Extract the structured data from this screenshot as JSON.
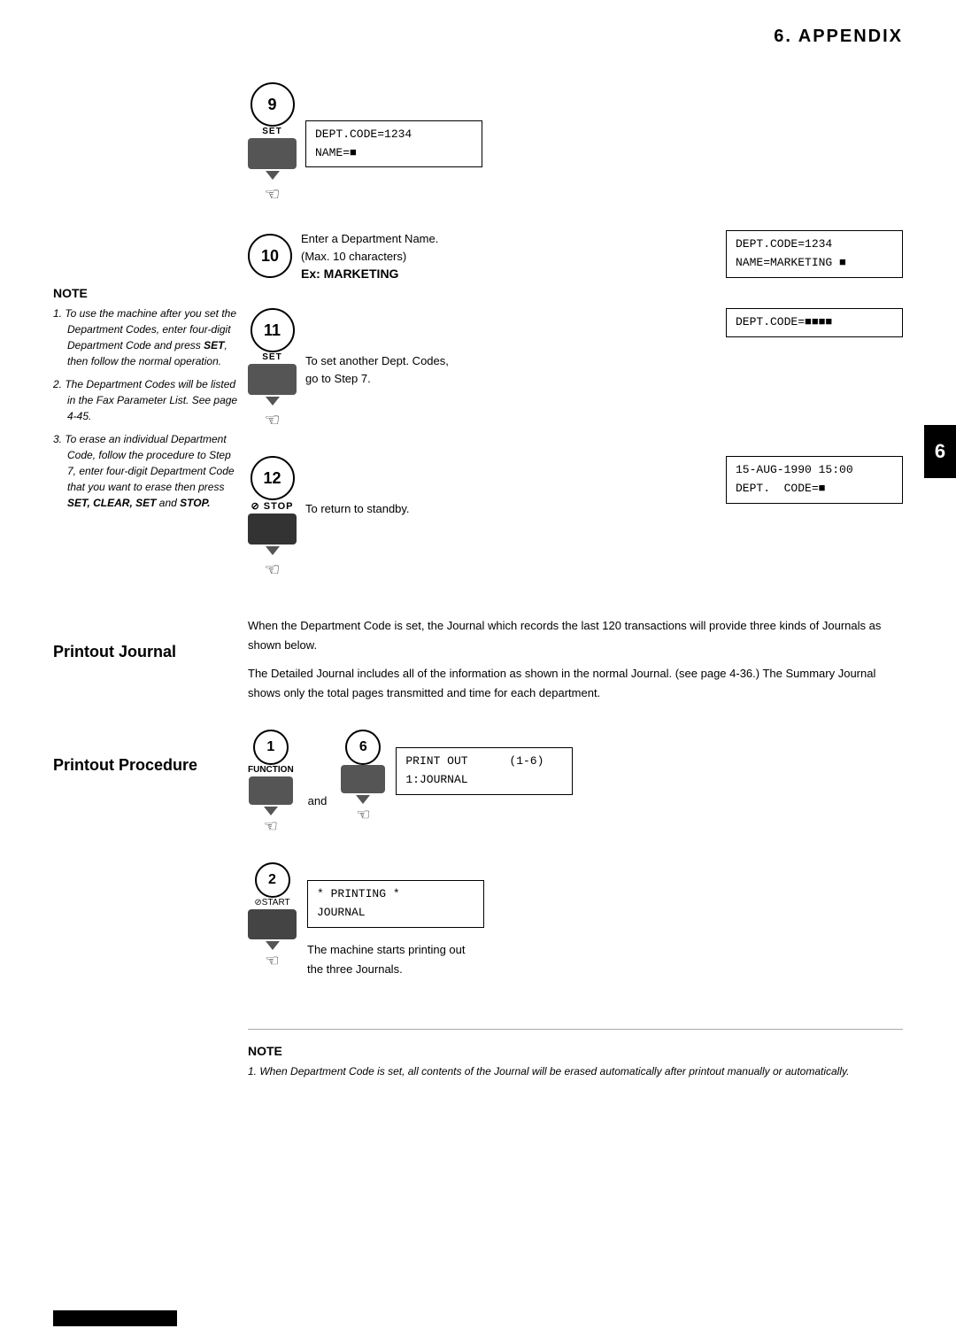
{
  "header": {
    "title": "6.  APPENDIX"
  },
  "tab": "6",
  "steps_top": [
    {
      "number": "9",
      "has_set_label": true,
      "set_label": "SET",
      "display": "DEPT.CODE=1234\nNAME=■"
    },
    {
      "number": "10",
      "description_line1": "Enter a Department Name.",
      "description_line2": "(Max. 10 characters)",
      "ex_label": "Ex:",
      "ex_value": "MARKETING",
      "display": "DEPT.CODE=1234\nNAME=MARKETING ■"
    },
    {
      "number": "11",
      "has_set_label": true,
      "set_label": "SET",
      "sub_note": "To set another Dept. Codes,\ngo to Step 7.",
      "display": "DEPT.CODE=■■■■"
    },
    {
      "number": "12",
      "has_stop_label": true,
      "stop_label": "⊘ STOP",
      "sub_note": "To return to standby.",
      "display": "15-AUG-1990 15:00\nDEPT.  CODE=■"
    }
  ],
  "note_left": {
    "title": "NOTE",
    "items": [
      {
        "num": "1",
        "text": "To use the machine after you set the Department Codes, enter four-digit Department Code and press SET, then follow the normal operation."
      },
      {
        "num": "2",
        "text": "The Department Codes will be listed in the Fax Parameter List. See page 4-45."
      },
      {
        "num": "3",
        "text": "To erase an individual Department Code, follow the procedure to Step 7, enter four-digit Department Code that you want to erase then press SET, CLEAR, SET and STOP."
      }
    ]
  },
  "printout_journal": {
    "label": "Printout Journal",
    "text1": "When the Department Code is set, the Journal which records the last 120 transactions will provide three kinds of Journals as shown below.",
    "text2": "The Detailed Journal includes all of the information as shown in the normal Journal. (see page 4-36.) The Summary Journal shows only the total pages transmitted and time for each department."
  },
  "printout_procedure": {
    "label": "Printout Procedure",
    "steps": [
      {
        "number": "1",
        "button_label": "FUNCTION",
        "and_text": "and",
        "second_number": "6",
        "display": "PRINT OUT      (1-6)\n1:JOURNAL"
      },
      {
        "number": "2",
        "button_label": "⊘START",
        "display": "* PRINTING *\nJOURNAL",
        "sub_note": "The machine starts printing out\nthe three Journals."
      }
    ]
  },
  "note_bottom": {
    "title": "NOTE",
    "items": [
      {
        "num": "1",
        "text": "When Department Code is set, all contents of the Journal will be erased automatically after printout manually or automatically."
      }
    ]
  }
}
